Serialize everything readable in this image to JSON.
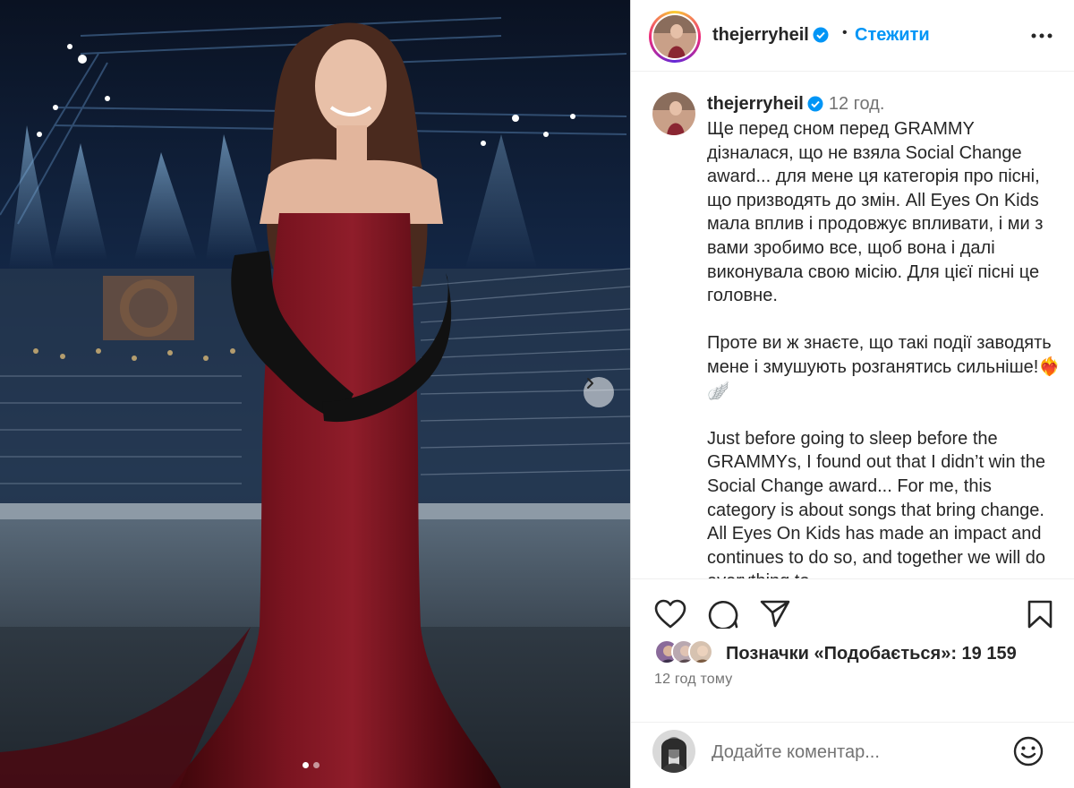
{
  "post": {
    "username": "thejerryheil",
    "follow_label": "Стежити",
    "separator": "•",
    "caption_time": "12 год.",
    "caption": "Ще перед сном перед GRAMMY дізналася, що не взяла Social Change award... для мене ця категорія про пісні, що призводять до змін. All Eyes On Kids мала вплив і продовжує впливати, і ми з вами зробимо все, щоб вона і далі виконувала свою місію. Для цієї пісні це головне.\n\nПроте ви ж знаєте, що такі події заводять мене і змушують розганятись сильніше!❤️‍🔥🪽\n\nJust before going to sleep before the GRAMMYs, I found out that I didn’t win the Social Change award... For me, this category is about songs that bring change. All Eyes On Kids has made an impact and continues to do so, and together we will do everything to",
    "likes_label": "Позначки «Подобається»: 19 159",
    "time_ago": "12 год тому",
    "comment_placeholder": "Додайте коментар..."
  },
  "icons": {
    "verified": "verified-badge-icon",
    "more": "more-options-icon",
    "like": "heart-icon",
    "comment": "comment-icon",
    "share": "send-icon",
    "save": "bookmark-icon",
    "emoji": "emoji-icon",
    "next": "chevron-right-icon"
  },
  "colors": {
    "accent": "#0095f6",
    "verified": "#0095f6",
    "dress": "#6e0f1a",
    "text": "#262626",
    "muted": "#737373"
  },
  "carousel": {
    "slides": 2,
    "active": 1
  }
}
